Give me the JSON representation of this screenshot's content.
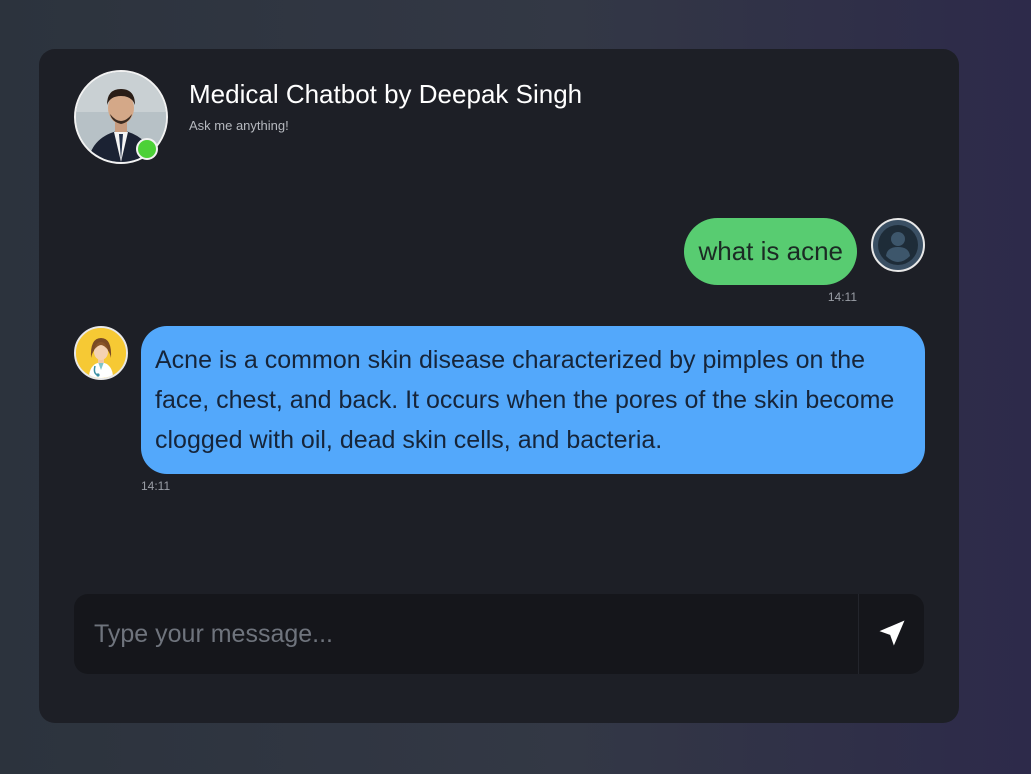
{
  "header": {
    "title": "Medical Chatbot by Deepak Singh",
    "subtitle": "Ask me anything!",
    "status": "online",
    "status_color": "#4cd137"
  },
  "messages": [
    {
      "sender": "user",
      "text": "what is acne",
      "time": "14:11",
      "bubble_color": "#58cc71",
      "avatar_icon": "user-icon"
    },
    {
      "sender": "bot",
      "text": "Acne is a common skin disease characterized by pimples on the face, chest, and back. It occurs when the pores of the skin become clogged with oil, dead skin cells, and bacteria.",
      "time": "14:11",
      "bubble_color": "#53a8fb",
      "avatar_icon": "doctor-icon"
    }
  ],
  "composer": {
    "placeholder": "Type your message...",
    "value": "",
    "send_icon": "send-icon"
  },
  "colors": {
    "card_background": "#1d1f26",
    "input_background": "#15161b"
  }
}
